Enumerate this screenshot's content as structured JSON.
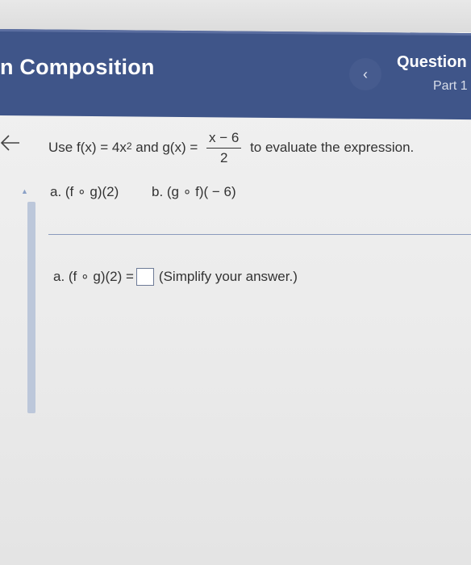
{
  "header": {
    "title": "n Composition",
    "question_label": "Question",
    "part_label": "Part 1",
    "prev_icon": "‹"
  },
  "problem": {
    "lead": "Use f(x) = 4x",
    "exponent": "2",
    "mid": " and g(x) = ",
    "frac_num": "x − 6",
    "frac_den": "2",
    "tail": " to evaluate the expression."
  },
  "parts": {
    "a": "a. (f ∘ g)(2)",
    "b": "b. (g ∘ f)( − 6)"
  },
  "answer": {
    "prefix": "a. (f ∘ g)(2) =",
    "hint": "(Simplify your answer.)"
  },
  "colors": {
    "header_bg": "#3f5589",
    "accent": "#8aa0c6"
  }
}
